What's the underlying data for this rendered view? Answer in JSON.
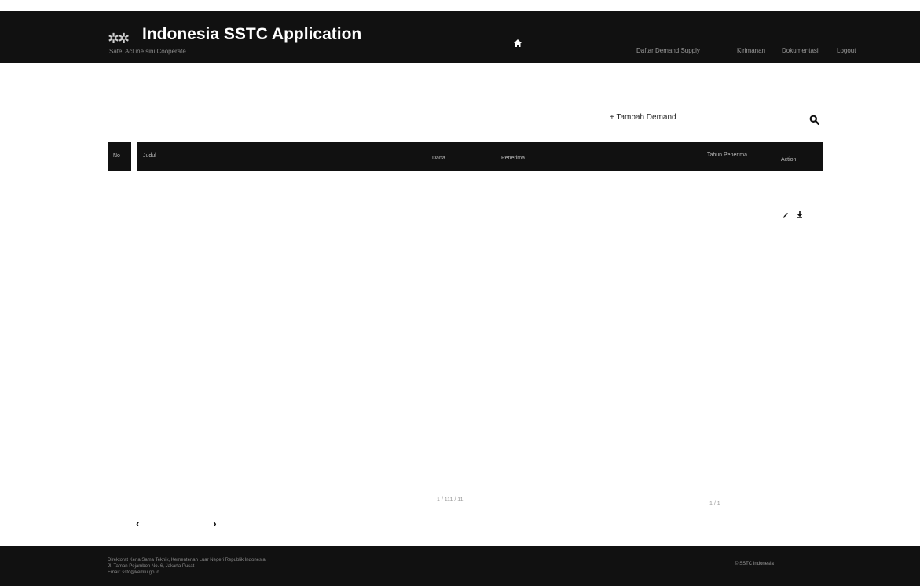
{
  "header": {
    "title": "Indonesia SSTC Application",
    "subtitle": "Satel   Acl  ine  sini  Cooperate",
    "nav": [
      {
        "label": "Daftar Demand Supply"
      },
      {
        "label": "Kirimanan"
      },
      {
        "label": "Dokumentasi"
      },
      {
        "label": "Logout"
      }
    ]
  },
  "toolbar": {
    "add_demand_label": "+ Tambah Demand"
  },
  "table": {
    "columns": [
      "No",
      "Judul",
      "Dana",
      "Penerima",
      "Tahun Penerima",
      "Action"
    ],
    "rows": []
  },
  "pagination": {
    "left_info": "...",
    "center_info": "1 / 111 / 11",
    "right_info": "1 / 1",
    "prev_label": "‹",
    "next_label": "›"
  },
  "footer": {
    "lines": [
      "Direktorat Kerja Sama Teknik, Kementerian Luar Negeri Republik Indonesia",
      "Jl. Taman Pejambon No. 6, Jakarta Pusat",
      "Email: sstc@kemlu.go.id"
    ],
    "right_text": "© SSTC Indonesia"
  },
  "colors": {
    "bar": "#111111",
    "background": "#ffffff"
  }
}
